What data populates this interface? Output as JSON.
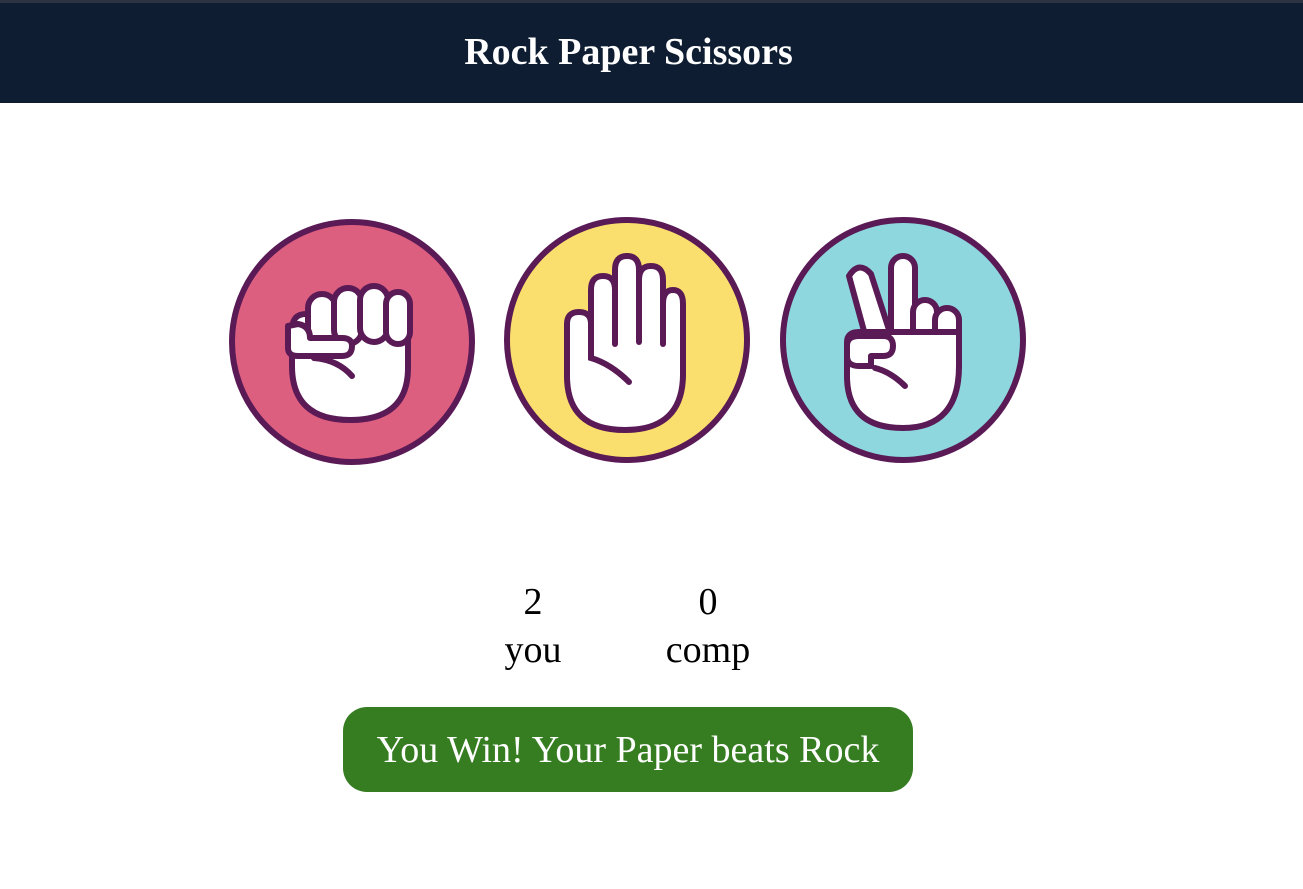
{
  "header": {
    "title": "Rock Paper Scissors"
  },
  "choices": [
    {
      "id": "rock",
      "icon": "fist-rock-icon",
      "color": "#dd5f7f"
    },
    {
      "id": "paper",
      "icon": "open-hand-paper-icon",
      "color": "#fbdf6e"
    },
    {
      "id": "scissors",
      "icon": "peace-hand-scissors-icon",
      "color": "#8ed7de"
    }
  ],
  "scoreboard": {
    "user_score": "2",
    "user_label": "you",
    "comp_score": "0",
    "comp_label": "comp"
  },
  "result": {
    "message": "You Win! Your Paper beats Rock",
    "color": "#367d22"
  },
  "colors": {
    "header_bg": "#0e1d31",
    "outline": "#5a1a56"
  }
}
